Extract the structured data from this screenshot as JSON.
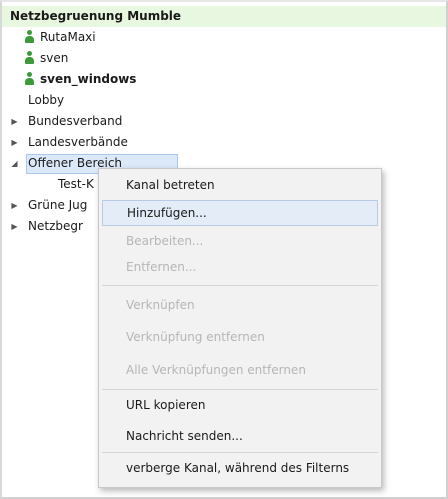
{
  "tree": {
    "root": {
      "label": "Netzbegruenung Mumble"
    },
    "users": [
      {
        "label": "RutaMaxi",
        "icon": "person-icon",
        "bold": false
      },
      {
        "label": "sven",
        "icon": "person-icon",
        "bold": false
      },
      {
        "label": "sven_windows",
        "icon": "person-icon",
        "bold": true
      }
    ],
    "channels": {
      "lobby": "Lobby",
      "bundesverband": "Bundesverband",
      "landesverbaende": "Landesverbände",
      "offener_bereich": "Offener Bereich",
      "test_k": "Test-K",
      "gruene_jugend": "Grüne Jug",
      "netzbegr": "Netzbegr"
    }
  },
  "context_menu": {
    "items": [
      {
        "label": "Kanal betreten",
        "enabled": true
      },
      {
        "label": "Hinzufügen...",
        "enabled": true,
        "highlighted": true
      },
      {
        "label": "Bearbeiten...",
        "enabled": false
      },
      {
        "label": "Entfernen...",
        "enabled": false
      },
      {
        "label": "Verknüpfen",
        "enabled": false
      },
      {
        "label": "Verknüpfung entfernen",
        "enabled": false
      },
      {
        "label": "Alle Verknüpfungen entfernen",
        "enabled": false
      },
      {
        "label": "URL kopieren",
        "enabled": true
      },
      {
        "label": "Nachricht senden...",
        "enabled": true
      },
      {
        "label": "verberge Kanal, während des Filterns",
        "enabled": true
      }
    ]
  },
  "colors": {
    "root_background": "#e8f7e0",
    "user_icon": "#3d9a3a",
    "selection": "#dce9f8",
    "menu_background": "#f2f2f2",
    "disabled_text": "#b6b6b6"
  }
}
